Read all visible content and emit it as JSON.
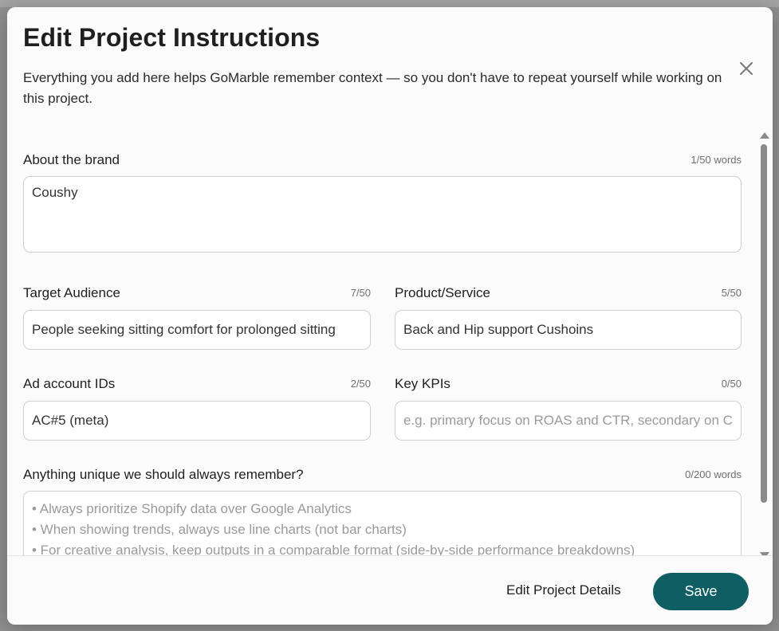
{
  "modal": {
    "title": "Edit Project Instructions",
    "subtitle": "Everything you add here helps GoMarble remember context — so you don't have to repeat yourself while working on this project."
  },
  "fields": {
    "about_brand": {
      "label": "About the brand",
      "count": "1/50 words",
      "value": "Coushy"
    },
    "target_audience": {
      "label": "Target Audience",
      "count": "7/50",
      "value": "People seeking sitting comfort for prolonged sitting"
    },
    "product_service": {
      "label": "Product/Service",
      "count": "5/50",
      "value": "Back and Hip support Cushoins"
    },
    "ad_account_ids": {
      "label": "Ad account IDs",
      "count": "2/50",
      "value": "AC#5 (meta)"
    },
    "key_kpis": {
      "label": "Key KPIs",
      "count": "0/50",
      "value": "",
      "placeholder": "e.g. primary focus on ROAS and CTR, secondary on CPA and CPM"
    },
    "unique": {
      "label": "Anything unique we should always remember?",
      "count": "0/200 words",
      "placeholder_lines": [
        "• Always prioritize Shopify data over Google Analytics",
        "• When showing trends, always use line charts (not bar charts)",
        "• For creative analysis, keep outputs in a comparable format (side-by-side performance breakdowns)"
      ]
    }
  },
  "footer": {
    "edit_details_label": "Edit Project Details",
    "save_label": "Save"
  },
  "icons": {
    "close": "close-icon",
    "scroll_up": "scroll-up-arrow-icon",
    "scroll_down": "scroll-down-arrow-icon"
  },
  "colors": {
    "primary": "#0f5e63",
    "overlay": "#8f8f8f",
    "modal_bg": "#fbfbfb"
  }
}
